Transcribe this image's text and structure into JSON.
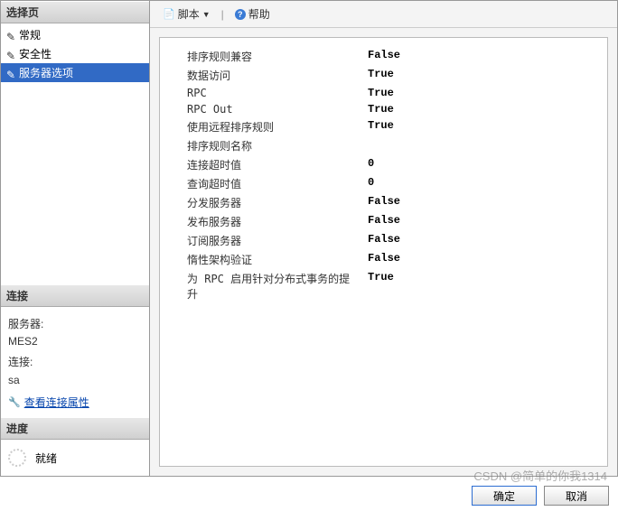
{
  "left": {
    "select_page_header": "选择页",
    "nav": [
      {
        "label": "常规",
        "selected": false
      },
      {
        "label": "安全性",
        "selected": false
      },
      {
        "label": "服务器选项",
        "selected": true
      }
    ],
    "connection_header": "连接",
    "server_label": "服务器:",
    "server_value": "MES2",
    "conn_label": "连接:",
    "conn_value": "sa",
    "view_props_link": "查看连接属性",
    "progress_header": "进度",
    "progress_status": "就绪"
  },
  "toolbar": {
    "script_label": "脚本",
    "help_label": "帮助"
  },
  "properties": [
    {
      "name": "排序规则兼容",
      "value": "False"
    },
    {
      "name": "数据访问",
      "value": "True"
    },
    {
      "name": "RPC",
      "value": "True"
    },
    {
      "name": "RPC Out",
      "value": "True"
    },
    {
      "name": "使用远程排序规则",
      "value": "True"
    },
    {
      "name": "排序规则名称",
      "value": ""
    },
    {
      "name": "连接超时值",
      "value": "0"
    },
    {
      "name": "查询超时值",
      "value": "0"
    },
    {
      "name": "分发服务器",
      "value": "False"
    },
    {
      "name": "发布服务器",
      "value": "False"
    },
    {
      "name": "订阅服务器",
      "value": "False"
    },
    {
      "name": "惰性架构验证",
      "value": "False"
    },
    {
      "name": "为 RPC 启用针对分布式事务的提升",
      "value": "True"
    }
  ],
  "buttons": {
    "ok": "确定",
    "cancel": "取消"
  },
  "watermark": "CSDN @简单的你我1314"
}
